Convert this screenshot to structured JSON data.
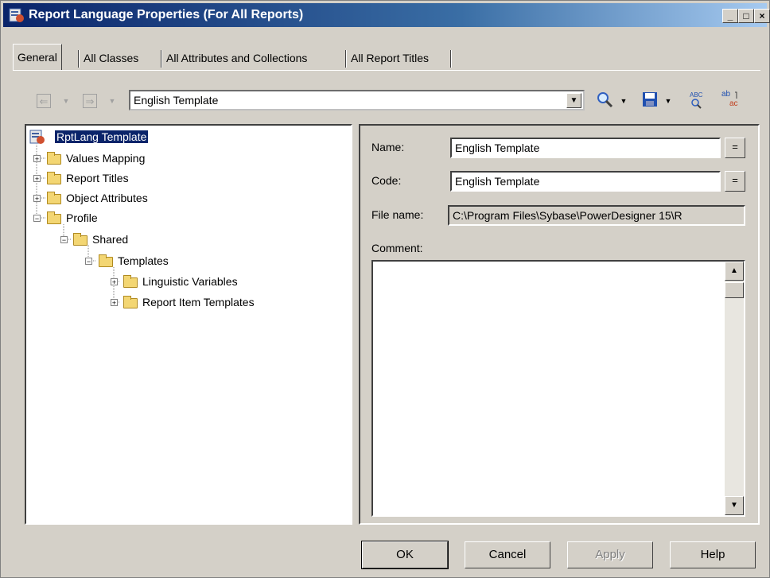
{
  "window": {
    "title": "Report Language Properties (For All Reports)"
  },
  "tabs": [
    {
      "label": "General"
    },
    {
      "label": "All Classes"
    },
    {
      "label": "All Attributes and Collections"
    },
    {
      "label": "All Report Titles"
    }
  ],
  "toolbar": {
    "template_value": "English Template"
  },
  "tree": {
    "root": "RptLang Template",
    "items": [
      {
        "label": "Values Mapping"
      },
      {
        "label": "Report Titles"
      },
      {
        "label": "Object Attributes"
      },
      {
        "label": "Profile"
      },
      {
        "label": "Shared"
      },
      {
        "label": "Templates"
      },
      {
        "label": "Linguistic Variables"
      },
      {
        "label": "Report Item Templates"
      }
    ]
  },
  "form": {
    "name_label": "Name:",
    "name_value": "English Template",
    "code_label": "Code:",
    "code_value": "English Template",
    "filename_label": "File name:",
    "filename_value": "C:\\Program Files\\Sybase\\PowerDesigner 15\\R",
    "comment_label": "Comment:",
    "eq_label": "="
  },
  "buttons": {
    "ok": "OK",
    "cancel": "Cancel",
    "apply": "Apply",
    "help": "Help"
  },
  "titlebar_buttons": {
    "minimize": "_",
    "maximize": "□",
    "close": "×"
  }
}
